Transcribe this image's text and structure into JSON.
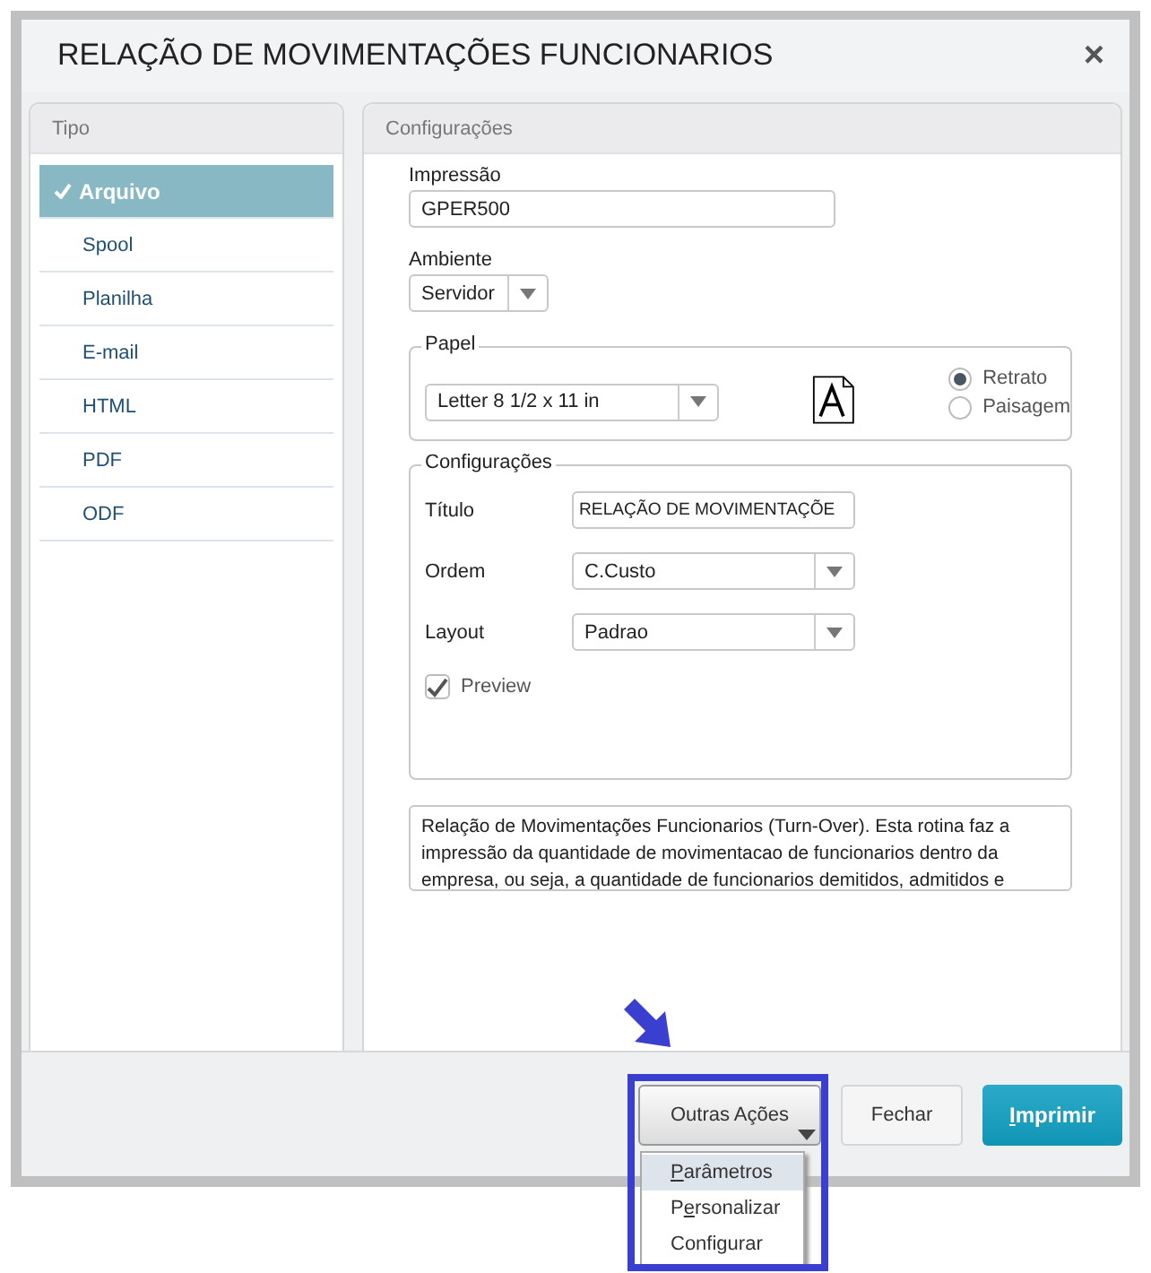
{
  "window": {
    "title": "RELAÇÃO DE MOVIMENTAÇÕES FUNCIONARIOS",
    "close": "×"
  },
  "sidebar": {
    "title": "Tipo",
    "items": [
      {
        "label": "Arquivo",
        "selected": true
      },
      {
        "label": "Spool",
        "selected": false
      },
      {
        "label": "Planilha",
        "selected": false
      },
      {
        "label": "E-mail",
        "selected": false
      },
      {
        "label": "HTML",
        "selected": false
      },
      {
        "label": "PDF",
        "selected": false
      },
      {
        "label": "ODF",
        "selected": false
      }
    ]
  },
  "panel": {
    "title": "Configurações",
    "impressao": {
      "label": "Impressão",
      "value": "GPER500"
    },
    "ambiente": {
      "label": "Ambiente",
      "value": "Servidor"
    },
    "papel": {
      "legend": "Papel",
      "value": "Letter 8 1/2 x 11 in",
      "orientations": [
        {
          "label": "Retrato",
          "selected": true
        },
        {
          "label": "Paisagem",
          "selected": false
        }
      ]
    },
    "config": {
      "legend": "Configurações",
      "fields": [
        {
          "kind": "text",
          "label": "Título",
          "value": "RELAÇÃO DE MOVIMENTAÇÕE"
        },
        {
          "kind": "select",
          "label": "Ordem",
          "value": "C.Custo"
        },
        {
          "kind": "select",
          "label": "Layout",
          "value": "Padrao"
        }
      ],
      "preview": {
        "label": "Preview",
        "checked": true
      }
    },
    "description": "Relação de Movimentações Funcionarios (Turn-Over). Esta rotina faz a impressão da quantidade de movimentacao de funcionarios dentro da empresa, ou seja,  a quantidade de funcionarios demitidos, admitidos e"
  },
  "footer": {
    "more": {
      "label": "Outras Ações",
      "expanded": true,
      "menu": [
        {
          "key": "P",
          "after": "arâmetros",
          "selected": true
        },
        {
          "before": "P",
          "key": "e",
          "after": "rsonalizar",
          "selected": false
        },
        {
          "before": "Configurar",
          "selected": false
        }
      ]
    },
    "close": "Fechar",
    "print": {
      "key": "I",
      "after": "mprimir"
    }
  }
}
